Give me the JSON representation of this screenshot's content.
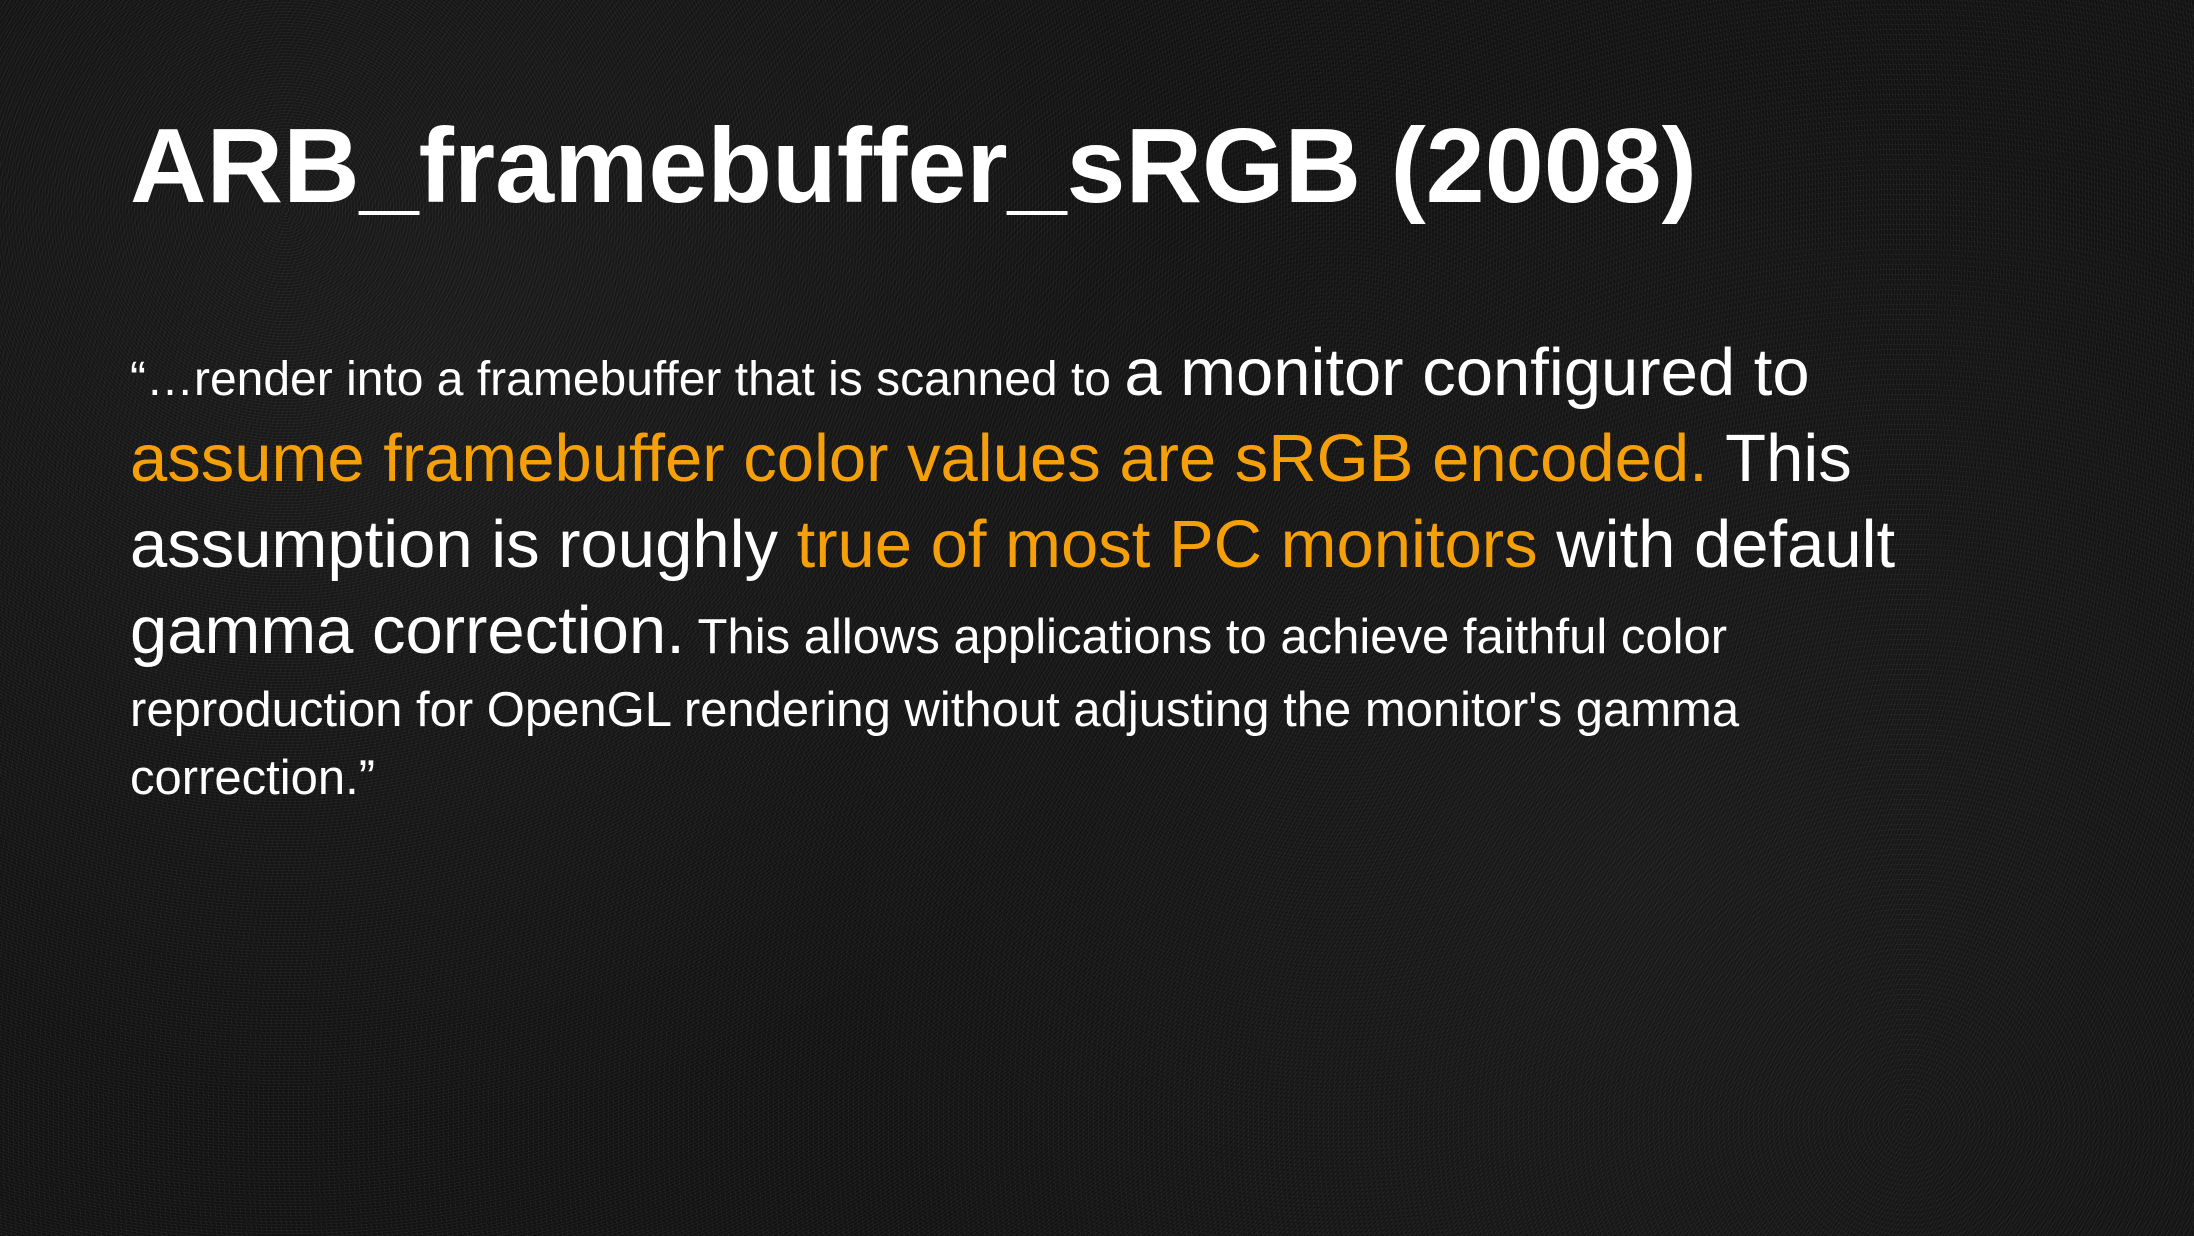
{
  "slide": {
    "title": "ARB_framebuffer_sRGB (2008)",
    "quote": {
      "line1": {
        "small": "“…render into a framebuffer that is scanned to ",
        "large": "a monitor configured to"
      },
      "line2": {
        "highlight": "assume framebuffer color values are sRGB encoded.",
        "rest": " This"
      },
      "line3": {
        "lead": "assumption is roughly ",
        "highlight": "true of most PC monitors",
        "rest": " with default"
      },
      "line4": {
        "large": "gamma correction.",
        "small": " This allows applications to achieve faithful color"
      },
      "line5": "reproduction for OpenGL rendering without adjusting the monitor's gamma",
      "line6": "correction.”"
    },
    "colors": {
      "background": "#141414",
      "text": "#ffffff",
      "highlight": "#f5a00a"
    }
  }
}
